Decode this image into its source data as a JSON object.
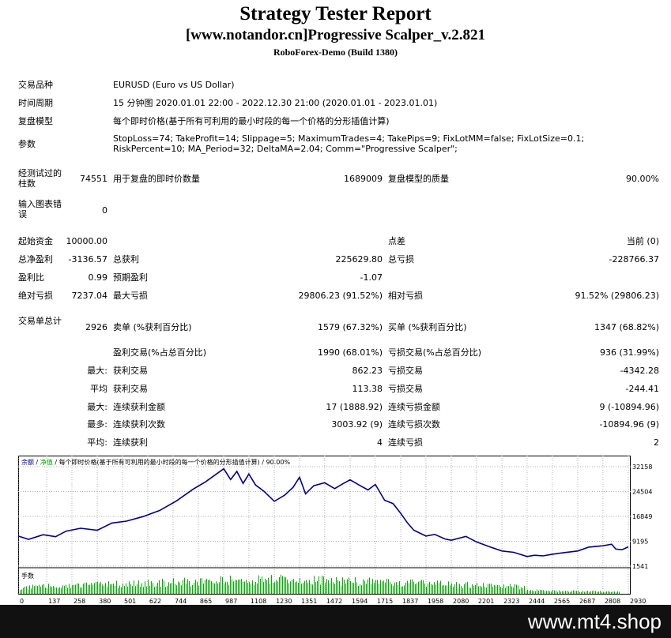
{
  "header": {
    "title": "Strategy Tester Report",
    "subtitle": "[www.notandor.cn]Progressive Scalper_v.2.821",
    "server": "RoboForex-Demo (Build 1380)"
  },
  "info": {
    "symbol_label": "交易品种",
    "symbol_value": "EURUSD (Euro vs US Dollar)",
    "period_label": "时间周期",
    "period_value": "15 分钟图 2020.01.01 22:00 - 2022.12.30 21:00 (2020.01.01 - 2023.01.01)",
    "model_label": "复盘模型",
    "model_value": "每个即时价格(基于所有可利用的最小时段的每一个价格的分形插值计算)",
    "params_label": "参数",
    "params_value": "StopLoss=74; TakeProfit=14; Slippage=5; MaximumTrades=4; TakePips=9; FixLotMM=false; FixLotSize=0.1; RiskPercent=10; MA_Period=32; DeltaMA=2.04; Comm=\"Progressive Scalper\";"
  },
  "bars": {
    "bars_label": "经测试过的柱数",
    "bars_value": "74551",
    "ticks_label": "用于复盘的即时价数量",
    "ticks_value": "1689009",
    "quality_label": "复盘模型的质量",
    "quality_value": "90.00%",
    "errors_label": "输入图表错误",
    "errors_value": "0"
  },
  "stats": {
    "deposit_label": "起始资金",
    "deposit_value": "10000.00",
    "spread_label": "点差",
    "spread_value": "当前 (0)",
    "net_label": "总净盈利",
    "net_value": "-3136.57",
    "gross_profit_label": "总获利",
    "gross_profit_value": "225629.80",
    "gross_loss_label": "总亏损",
    "gross_loss_value": "-228766.37",
    "pf_label": "盈利比",
    "pf_value": "0.99",
    "payoff_label": "预期盈利",
    "payoff_value": "-1.07",
    "abs_dd_label": "绝对亏损",
    "abs_dd_value": "7237.04",
    "max_dd_label": "最大亏损",
    "max_dd_value": "29806.23 (91.52%)",
    "rel_dd_label": "相对亏损",
    "rel_dd_value": "91.52% (29806.23)"
  },
  "trades": {
    "total_label": "交易单总计",
    "total_value": "2926",
    "short_label": "卖单 (%获利百分比)",
    "short_value": "1579 (67.32%)",
    "long_label": "买单 (%获利百分比)",
    "long_value": "1347 (68.82%)",
    "win_label": "盈利交易(%占总百分比)",
    "win_value": "1990 (68.01%)",
    "loss_label": "亏损交易(%占总百分比)",
    "loss_value": "936 (31.99%)",
    "largest_prefix": "最大:",
    "largest_win_label": "获利交易",
    "largest_win_value": "862.23",
    "largest_loss_label": "亏损交易",
    "largest_loss_value": "-4342.28",
    "avg_prefix": "平均",
    "avg_win_label": "获利交易",
    "avg_win_value": "113.38",
    "avg_loss_label": "亏损交易",
    "avg_loss_value": "-244.41",
    "max_prefix": "最大:",
    "max_consec_win_label": "连续获利金额",
    "max_consec_win_value": "17 (1888.92)",
    "max_consec_loss_label": "连续亏损金额",
    "max_consec_loss_value": "9 (-10894.96)",
    "most_prefix": "最多:",
    "most_consec_win_label": "连续获利次数",
    "most_consec_win_value": "3003.92 (9)",
    "most_consec_loss_label": "连续亏损次数",
    "most_consec_loss_value": "-10894.96 (9)",
    "avg2_prefix": "平均:",
    "avg_consec_win_label": "连续获利",
    "avg_consec_win_value": "4",
    "avg_consec_loss_label": "连续亏损",
    "avg_consec_loss_value": "2"
  },
  "chart_legend": {
    "balance": "余额",
    "sep1": " / ",
    "equity": "净值",
    "rest": " / 每个即时价格(基于所有可利用的最小时段的每一个价格的分形插值计算) / 90.00%",
    "volume": "手数"
  },
  "chart_data": {
    "type": "line",
    "y_ticks": [
      "32158",
      "24504",
      "16849",
      "9195",
      "1541"
    ],
    "x_ticks": [
      "0",
      "137",
      "258",
      "380",
      "501",
      "622",
      "744",
      "865",
      "987",
      "1108",
      "1230",
      "1351",
      "1472",
      "1594",
      "1715",
      "1837",
      "1958",
      "2080",
      "2201",
      "2323",
      "2444",
      "2565",
      "2687",
      "2808",
      "2930"
    ],
    "ylim": [
      1541,
      32158
    ],
    "xlim": [
      0,
      2930
    ],
    "series": [
      {
        "name": "余额",
        "color": "#00008b",
        "x": [
          0,
          50,
          120,
          180,
          230,
          300,
          380,
          450,
          520,
          600,
          680,
          760,
          840,
          900,
          950,
          987,
          1020,
          1050,
          1080,
          1108,
          1140,
          1180,
          1230,
          1280,
          1320,
          1351,
          1380,
          1420,
          1472,
          1520,
          1560,
          1594,
          1640,
          1680,
          1715,
          1760,
          1800,
          1837,
          1870,
          1900,
          1958,
          2000,
          2050,
          2080,
          2150,
          2201,
          2260,
          2323,
          2380,
          2444,
          2480,
          2520,
          2565,
          2620,
          2687,
          2740,
          2808,
          2850,
          2870,
          2900,
          2930
        ],
        "y": [
          10800,
          9800,
          11200,
          10600,
          12300,
          13200,
          12600,
          14800,
          15400,
          16800,
          18700,
          21600,
          25200,
          27500,
          29800,
          31500,
          28200,
          30700,
          27000,
          29900,
          26500,
          24600,
          21500,
          23400,
          25800,
          28900,
          23800,
          26300,
          27200,
          25400,
          26900,
          28100,
          26400,
          25000,
          26700,
          21800,
          20800,
          17800,
          14800,
          12600,
          10800,
          11300,
          9900,
          9500,
          10700,
          9000,
          7600,
          6200,
          5800,
          4500,
          4900,
          4700,
          5200,
          5700,
          6200,
          7400,
          7800,
          8300,
          6800,
          6600,
          7500
        ]
      }
    ],
    "volume": {
      "color": "#00b000"
    }
  }
}
